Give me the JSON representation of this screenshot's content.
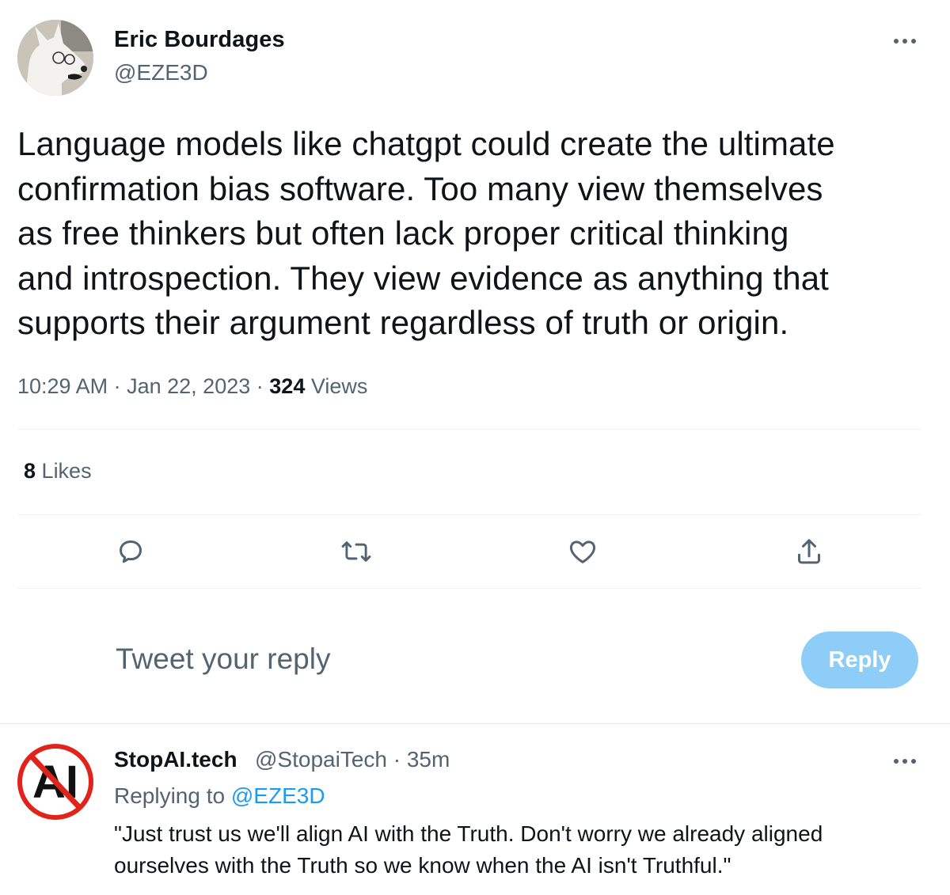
{
  "tweet": {
    "author": {
      "name": "Eric Bourdages",
      "handle": "@EZE3D"
    },
    "text_lines": [
      "Language models like chatgpt could create the ultimate",
      "confirmation bias software. Too many view themselves",
      "as free thinkers but often lack proper critical thinking",
      "and introspection. They view evidence as anything that",
      "supports their argument regardless of truth or origin."
    ],
    "time": "10:29 AM",
    "date": "Jan 22, 2023",
    "views_count": "324",
    "views_label": "Views",
    "likes_count": "8",
    "likes_label": "Likes",
    "separator": "·",
    "actions": [
      "reply-icon",
      "retweet-icon",
      "like-icon",
      "share-icon"
    ]
  },
  "compose": {
    "placeholder": "Tweet your reply",
    "button_label": "Reply"
  },
  "reply": {
    "author": {
      "name": "StopAI.tech",
      "handle": "@StopaiTech"
    },
    "age": "35m",
    "replying_prefix": "Replying to",
    "replying_to": "@EZE3D",
    "text_lines": [
      "\"Just trust us we'll align AI with the Truth. Don't worry we already aligned",
      "ourselves with the Truth so we know when the AI isn't Truthful.\""
    ],
    "avatar_text": "AI"
  },
  "colors": {
    "accent": "#1d9bf0",
    "reply_button_disabled": "#8ecdf8",
    "secondary_text": "#536471",
    "stop_red": "#e0241b"
  }
}
